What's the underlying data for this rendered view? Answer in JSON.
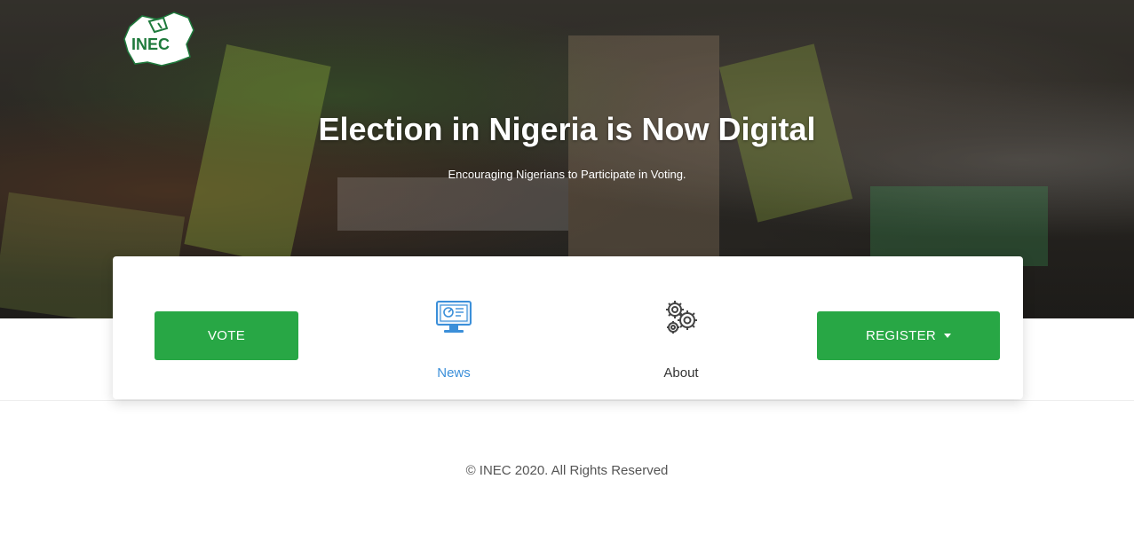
{
  "hero": {
    "logo_text": "INEC",
    "title": "Election in Nigeria is Now Digital",
    "subtitle": "Encouraging Nigerians to Participate in Voting."
  },
  "card": {
    "vote_label": "VOTE",
    "news_label": "News",
    "about_label": "About",
    "register_label": "REGISTER",
    "news_icon": "computer-monitor-icon",
    "about_icon": "gears-icon"
  },
  "footer": {
    "copyright": "© INEC 2020. All Rights Reserved"
  },
  "colors": {
    "accent_green": "#28a745",
    "link_blue": "#3b8fd9"
  }
}
